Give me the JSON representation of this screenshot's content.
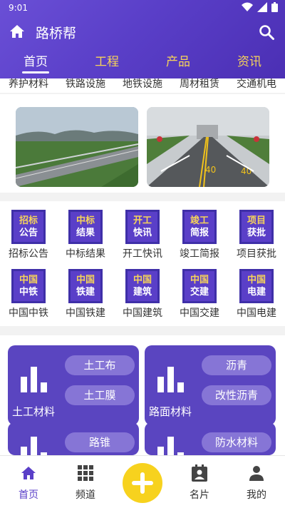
{
  "status": {
    "time": "9:01"
  },
  "app": {
    "title": "路桥帮"
  },
  "tabs": [
    {
      "label": "首页"
    },
    {
      "label": "工程"
    },
    {
      "label": "产品"
    },
    {
      "label": "资讯"
    }
  ],
  "categories": [
    "养护材料",
    "铁路设施",
    "地铁设施",
    "周材租赁",
    "交通机电"
  ],
  "news": [
    {
      "top": "招标",
      "bottom": "公告",
      "label": "招标公告"
    },
    {
      "top": "中标",
      "bottom": "结果",
      "label": "中标结果"
    },
    {
      "top": "开工",
      "bottom": "快讯",
      "label": "开工快讯"
    },
    {
      "top": "竣工",
      "bottom": "简报",
      "label": "竣工简报"
    },
    {
      "top": "项目",
      "bottom": "获批",
      "label": "项目获批"
    },
    {
      "top": "中国",
      "bottom": "中铁",
      "label": "中国中铁"
    },
    {
      "top": "中国",
      "bottom": "铁建",
      "label": "中国铁建"
    },
    {
      "top": "中国",
      "bottom": "建筑",
      "label": "中国建筑"
    },
    {
      "top": "中国",
      "bottom": "交建",
      "label": "中国交建"
    },
    {
      "top": "中国",
      "bottom": "电建",
      "label": "中国电建"
    }
  ],
  "materials": [
    {
      "title": "土工材料",
      "items": [
        "土工布",
        "土工膜"
      ]
    },
    {
      "title": "路面材料",
      "items": [
        "沥青",
        "改性沥青"
      ]
    },
    {
      "title": "",
      "items": [
        "路锥"
      ]
    },
    {
      "title": "",
      "items": [
        "防水材料"
      ]
    }
  ],
  "bottom_nav": [
    {
      "label": "首页",
      "icon": "home-icon"
    },
    {
      "label": "频道",
      "icon": "grid-icon"
    },
    {
      "label": "",
      "icon": "plus-icon"
    },
    {
      "label": "名片",
      "icon": "card-icon"
    },
    {
      "label": "我的",
      "icon": "person-icon"
    }
  ],
  "colors": {
    "primary": "#5a3fc8",
    "accent": "#f6d35a",
    "fab": "#f7d21e"
  }
}
